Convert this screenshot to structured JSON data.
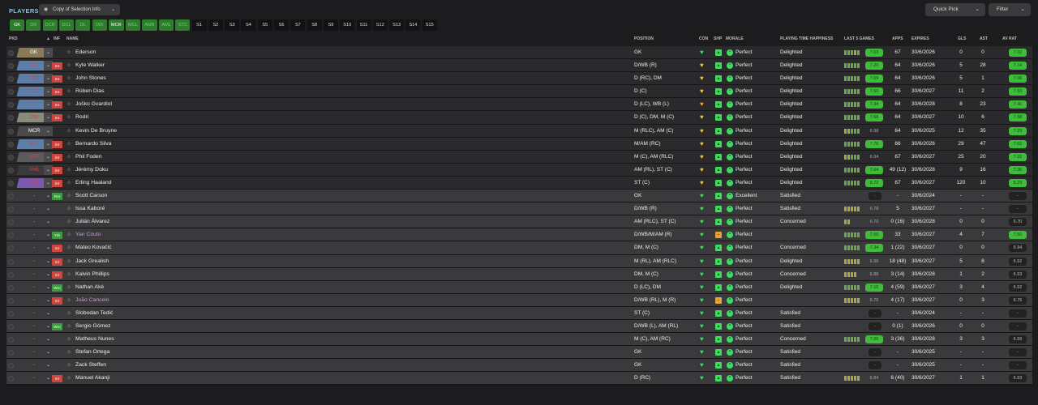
{
  "title": "PLAYERS",
  "view_select": {
    "label": "Copy of Selection Info",
    "icon": "eye-icon"
  },
  "buttons": {
    "quick_pick": "Quick Pick",
    "filter": "Filter"
  },
  "tabs": [
    {
      "label": "GK",
      "style": "green white"
    },
    {
      "label": "DR",
      "style": "green"
    },
    {
      "label": "DCR",
      "style": "green"
    },
    {
      "label": "DCL",
      "style": "green"
    },
    {
      "label": "DL",
      "style": "green"
    },
    {
      "label": "DM",
      "style": "green"
    },
    {
      "label": "MCR",
      "style": "green white"
    },
    {
      "label": "MCL",
      "style": "green"
    },
    {
      "label": "AMR",
      "style": "green"
    },
    {
      "label": "AML",
      "style": "green"
    },
    {
      "label": "STC",
      "style": "green"
    },
    {
      "label": "S1",
      "style": ""
    },
    {
      "label": "S2",
      "style": ""
    },
    {
      "label": "S3",
      "style": ""
    },
    {
      "label": "S4",
      "style": ""
    },
    {
      "label": "S5",
      "style": ""
    },
    {
      "label": "S6",
      "style": ""
    },
    {
      "label": "S7",
      "style": ""
    },
    {
      "label": "S8",
      "style": ""
    },
    {
      "label": "S9",
      "style": ""
    },
    {
      "label": "S10",
      "style": ""
    },
    {
      "label": "S11",
      "style": ""
    },
    {
      "label": "S12",
      "style": ""
    },
    {
      "label": "S13",
      "style": ""
    },
    {
      "label": "S14",
      "style": ""
    },
    {
      "label": "S15",
      "style": ""
    }
  ],
  "columns": {
    "pkd": "PKD",
    "inf": "INF",
    "name": "NAME",
    "position": "POSITION",
    "con": "CON",
    "shp": "SHP",
    "morale": "MORALE",
    "pth": "PLAYING TIME HAPPINESS",
    "last5": "LAST 5 GAMES",
    "apps": "APPS",
    "expires": "EXPIRES",
    "gls": "GLS",
    "ast": "AST",
    "avrat": "AV RAT"
  },
  "rows": [
    {
      "pos": "GK",
      "posclass": "pos-gk",
      "inf": "",
      "name": "Ederson",
      "position": "GK",
      "con": "green",
      "shp": "green",
      "morale": "Perfect",
      "pth": "Delighted",
      "bars": "gggyg",
      "rating": "7.03",
      "apps": "67",
      "expires": "30/6/2026",
      "gls": "0",
      "ast": "0",
      "avrat": "7.02",
      "avr_dim": false,
      "loan": false,
      "group": "first"
    },
    {
      "pos": "DR",
      "posclass": "pos-def",
      "inf": "Int",
      "name": "Kyle Walker",
      "position": "D/WB (R)",
      "con": "yellow",
      "shp": "green",
      "morale": "Perfect",
      "pth": "Delighted",
      "bars": "ggggg",
      "rating": "7.20",
      "apps": "64",
      "expires": "30/6/2026",
      "gls": "5",
      "ast": "28",
      "avrat": "7.14",
      "avr_dim": false,
      "loan": false,
      "group": "first"
    },
    {
      "pos": "DCR",
      "posclass": "pos-def",
      "inf": "Int",
      "name": "John Stones",
      "position": "D (RC), DM",
      "con": "yellow",
      "shp": "green",
      "morale": "Perfect",
      "pth": "Delighted",
      "bars": "ggggg",
      "rating": "7.09",
      "apps": "64",
      "expires": "30/6/2026",
      "gls": "5",
      "ast": "1",
      "avrat": "7.06",
      "avr_dim": false,
      "loan": false,
      "group": "first"
    },
    {
      "pos": "DCL",
      "posclass": "pos-def",
      "inf": "Int",
      "name": "Rúben Dias",
      "position": "D (C)",
      "con": "yellow",
      "shp": "green",
      "morale": "Perfect",
      "pth": "Delighted",
      "bars": "ggggg",
      "rating": "7.50",
      "apps": "66",
      "expires": "30/6/2027",
      "gls": "11",
      "ast": "2",
      "avrat": "7.53",
      "avr_dim": false,
      "loan": false,
      "group": "first"
    },
    {
      "pos": "DL",
      "posclass": "pos-def",
      "inf": "Int",
      "name": "Joško Gvardiol",
      "position": "D (LC), WB (L)",
      "con": "orange",
      "shp": "green",
      "morale": "Perfect",
      "pth": "Delighted",
      "bars": "ggggg",
      "rating": "7.34",
      "apps": "64",
      "expires": "30/6/2028",
      "gls": "8",
      "ast": "23",
      "avrat": "7.41",
      "avr_dim": false,
      "loan": false,
      "group": "first"
    },
    {
      "pos": "DM",
      "posclass": "pos-dm",
      "inf": "Int",
      "name": "Rodri",
      "position": "D (C), DM, M (C)",
      "con": "yellow",
      "shp": "green",
      "morale": "Perfect",
      "pth": "Delighted",
      "bars": "ggggg",
      "rating": "7.68",
      "apps": "64",
      "expires": "30/6/2027",
      "gls": "10",
      "ast": "6",
      "avrat": "7.58",
      "avr_dim": false,
      "loan": false,
      "group": "first"
    },
    {
      "pos": "MCR",
      "posclass": "pos-mcr",
      "inf": "",
      "name": "Kevin De Bruyne",
      "position": "M (RLC), AM (C)",
      "con": "yellow",
      "shp": "green",
      "morale": "Perfect",
      "pth": "Delighted",
      "bars": "yyggg",
      "rating": "6.98",
      "apps": "64",
      "expires": "30/6/2025",
      "gls": "12",
      "ast": "35",
      "avrat": "7.29",
      "avr_dim": false,
      "loan": false,
      "group": "first"
    },
    {
      "pos": "MCL",
      "posclass": "pos-def",
      "inf": "Int",
      "name": "Bernardo Silva",
      "position": "M/AM (RC)",
      "con": "yellow",
      "shp": "green",
      "morale": "Perfect",
      "pth": "Delighted",
      "bars": "ggggg",
      "rating": "7.76",
      "apps": "66",
      "expires": "30/6/2026",
      "gls": "29",
      "ast": "47",
      "avrat": "7.62",
      "avr_dim": false,
      "loan": false,
      "group": "first"
    },
    {
      "pos": "AMR",
      "posclass": "pos-mid",
      "inf": "Int",
      "name": "Phil Foden",
      "position": "M (C), AM (RLC)",
      "con": "yellow",
      "shp": "green",
      "morale": "Perfect",
      "pth": "Delighted",
      "bars": "yyggg",
      "rating": "6.94",
      "apps": "67",
      "expires": "30/6/2027",
      "gls": "25",
      "ast": "20",
      "avrat": "7.22",
      "avr_dim": false,
      "loan": false,
      "group": "first"
    },
    {
      "pos": "AML",
      "posclass": "pos-amr",
      "inf": "Int",
      "name": "Jérémy Doku",
      "position": "AM (RL), ST (C)",
      "con": "yellow",
      "shp": "green",
      "morale": "Perfect",
      "pth": "Delighted",
      "bars": "ggggg",
      "rating": "7.64",
      "apps": "49 (12)",
      "expires": "30/6/2028",
      "gls": "9",
      "ast": "16",
      "avrat": "7.36",
      "avr_dim": false,
      "loan": false,
      "group": "first"
    },
    {
      "pos": "STC",
      "posclass": "pos-st",
      "inf": "Int",
      "name": "Erling Haaland",
      "position": "ST (C)",
      "con": "yellow",
      "shp": "green",
      "morale": "Perfect",
      "pth": "Delighted",
      "bars": "ggggg",
      "rating": "8.72",
      "apps": "67",
      "expires": "30/6/2027",
      "gls": "120",
      "ast": "10",
      "avrat": "8.29",
      "avr_dim": false,
      "loan": false,
      "group": "first"
    },
    {
      "pos": "-",
      "posclass": "pos-dash",
      "inf": "Rot",
      "name": "Scott Carson",
      "position": "GK",
      "con": "green",
      "shp": "green",
      "morale": "Excellent",
      "pth": "Satisfied",
      "bars": "",
      "rating": "-",
      "apps": "-",
      "expires": "30/6/2024",
      "gls": "-",
      "ast": "-",
      "avrat": "-",
      "avr_dim": true,
      "loan": false,
      "group": "rest"
    },
    {
      "pos": "-",
      "posclass": "pos-dash",
      "inf": "",
      "name": "Issa Kaboré",
      "position": "D/WB (R)",
      "con": "green",
      "shp": "green",
      "morale": "Perfect",
      "pth": "Satisfied",
      "bars": "yyyyy",
      "rating": "6.78",
      "apps": "5",
      "expires": "30/6/2027",
      "gls": "-",
      "ast": "-",
      "avrat": "-",
      "avr_dim": true,
      "loan": false,
      "group": "rest"
    },
    {
      "pos": "-",
      "posclass": "pos-dash",
      "inf": "",
      "name": "Julián Álvarez",
      "position": "AM (RLC), ST (C)",
      "con": "green",
      "shp": "green",
      "morale": "Perfect",
      "pth": "Concerned",
      "bars": "yy",
      "rating": "6.70",
      "apps": "0 (16)",
      "expires": "30/6/2028",
      "gls": "0",
      "ast": "0",
      "avrat": "6.70",
      "avr_dim": true,
      "loan": false,
      "group": "rest"
    },
    {
      "pos": "-",
      "posclass": "pos-dash",
      "inf": "Yth",
      "name": "Yan Couto",
      "position": "D/WB/M/AM (R)",
      "con": "green",
      "shp": "orange",
      "morale": "Perfect",
      "pth": "",
      "bars": "ggggg",
      "rating": "7.50",
      "apps": "33",
      "expires": "30/6/2027",
      "gls": "4",
      "ast": "7",
      "avrat": "7.50",
      "avr_dim": false,
      "loan": true,
      "group": "rest"
    },
    {
      "pos": "-",
      "posclass": "pos-dash",
      "inf": "Int",
      "name": "Mateo Kovačić",
      "position": "DM, M (C)",
      "con": "green",
      "shp": "green",
      "morale": "Perfect",
      "pth": "Concerned",
      "bars": "ggggg",
      "rating": "7.34",
      "apps": "1 (22)",
      "expires": "30/6/2027",
      "gls": "0",
      "ast": "0",
      "avrat": "6.94",
      "avr_dim": true,
      "loan": false,
      "group": "rest"
    },
    {
      "pos": "-",
      "posclass": "pos-dash",
      "inf": "Int",
      "name": "Jack Grealish",
      "position": "M (RL), AM (RLC)",
      "con": "green",
      "shp": "green",
      "morale": "Perfect",
      "pth": "Delighted",
      "bars": "yyyyy",
      "rating": "6.96",
      "apps": "18 (48)",
      "expires": "30/6/2027",
      "gls": "5",
      "ast": "8",
      "avrat": "6.92",
      "avr_dim": true,
      "loan": false,
      "group": "rest"
    },
    {
      "pos": "-",
      "posclass": "pos-dash",
      "inf": "Int",
      "name": "Kalvin Phillips",
      "position": "DM, M (C)",
      "con": "green",
      "shp": "green",
      "morale": "Perfect",
      "pth": "Concerned",
      "bars": "yyyy",
      "rating": "6.88",
      "apps": "3 (14)",
      "expires": "30/6/2028",
      "gls": "1",
      "ast": "2",
      "avrat": "6.93",
      "avr_dim": true,
      "loan": false,
      "group": "rest"
    },
    {
      "pos": "-",
      "posclass": "pos-dash",
      "inf": "Wnt",
      "name": "Nathan Aké",
      "position": "D (LC), DM",
      "con": "green",
      "shp": "green",
      "morale": "Perfect",
      "pth": "Delighted",
      "bars": "ggggg",
      "rating": "7.10",
      "apps": "4 (59)",
      "expires": "30/6/2027",
      "gls": "3",
      "ast": "4",
      "avrat": "6.92",
      "avr_dim": true,
      "loan": false,
      "group": "rest"
    },
    {
      "pos": "-",
      "posclass": "pos-dash",
      "inf": "Int",
      "name": "João Cancelo",
      "position": "D/WB (RL), M (R)",
      "con": "green",
      "shp": "orange",
      "morale": "Perfect",
      "pth": "",
      "bars": "yyyyy",
      "rating": "6.70",
      "apps": "4 (17)",
      "expires": "30/6/2027",
      "gls": "0",
      "ast": "3",
      "avrat": "6.76",
      "avr_dim": true,
      "loan": true,
      "group": "rest"
    },
    {
      "pos": "-",
      "posclass": "pos-dash",
      "inf": "",
      "name": "Slobodan Tedić",
      "position": "ST (C)",
      "con": "green",
      "shp": "green",
      "morale": "Perfect",
      "pth": "Satisfied",
      "bars": "",
      "rating": "-",
      "apps": "-",
      "expires": "30/6/2024",
      "gls": "-",
      "ast": "-",
      "avrat": "-",
      "avr_dim": true,
      "loan": false,
      "group": "rest"
    },
    {
      "pos": "-",
      "posclass": "pos-dash",
      "inf": "Wnt",
      "name": "Sergio Gómez",
      "position": "D/WB (L), AM (RL)",
      "con": "green",
      "shp": "green",
      "morale": "Perfect",
      "pth": "Satisfied",
      "bars": "",
      "rating": "-",
      "apps": "0 (1)",
      "expires": "30/6/2026",
      "gls": "0",
      "ast": "0",
      "avrat": "-",
      "avr_dim": true,
      "loan": false,
      "group": "rest"
    },
    {
      "pos": "-",
      "posclass": "pos-dash",
      "inf": "",
      "name": "Matheus Nunes",
      "position": "M (C), AM (RC)",
      "con": "green",
      "shp": "green",
      "morale": "Perfect",
      "pth": "Concerned",
      "bars": "ggggg",
      "rating": "7.00",
      "apps": "3 (36)",
      "expires": "30/6/2028",
      "gls": "3",
      "ast": "3",
      "avrat": "6.99",
      "avr_dim": true,
      "loan": false,
      "group": "rest"
    },
    {
      "pos": "-",
      "posclass": "pos-dash",
      "inf": "",
      "name": "Stefan Ortega",
      "position": "GK",
      "con": "green",
      "shp": "green",
      "morale": "Perfect",
      "pth": "Satisfied",
      "bars": "",
      "rating": "-",
      "apps": "-",
      "expires": "30/6/2025",
      "gls": "-",
      "ast": "-",
      "avrat": "-",
      "avr_dim": true,
      "loan": false,
      "group": "rest"
    },
    {
      "pos": "-",
      "posclass": "pos-dash",
      "inf": "",
      "name": "Zack Steffen",
      "position": "GK",
      "con": "green",
      "shp": "green",
      "morale": "Perfect",
      "pth": "Satisfied",
      "bars": "",
      "rating": "-",
      "apps": "-",
      "expires": "30/6/2025",
      "gls": "-",
      "ast": "-",
      "avrat": "-",
      "avr_dim": true,
      "loan": false,
      "group": "rest"
    },
    {
      "pos": "-",
      "posclass": "pos-dash",
      "inf": "Int",
      "name": "Manuel Akanji",
      "position": "D (RC)",
      "con": "green",
      "shp": "green",
      "morale": "Perfect",
      "pth": "Satisfied",
      "bars": "yyyyy",
      "rating": "6.84",
      "apps": "6 (40)",
      "expires": "30/6/2027",
      "gls": "1",
      "ast": "1",
      "avrat": "6.93",
      "avr_dim": true,
      "loan": false,
      "group": "rest"
    }
  ]
}
